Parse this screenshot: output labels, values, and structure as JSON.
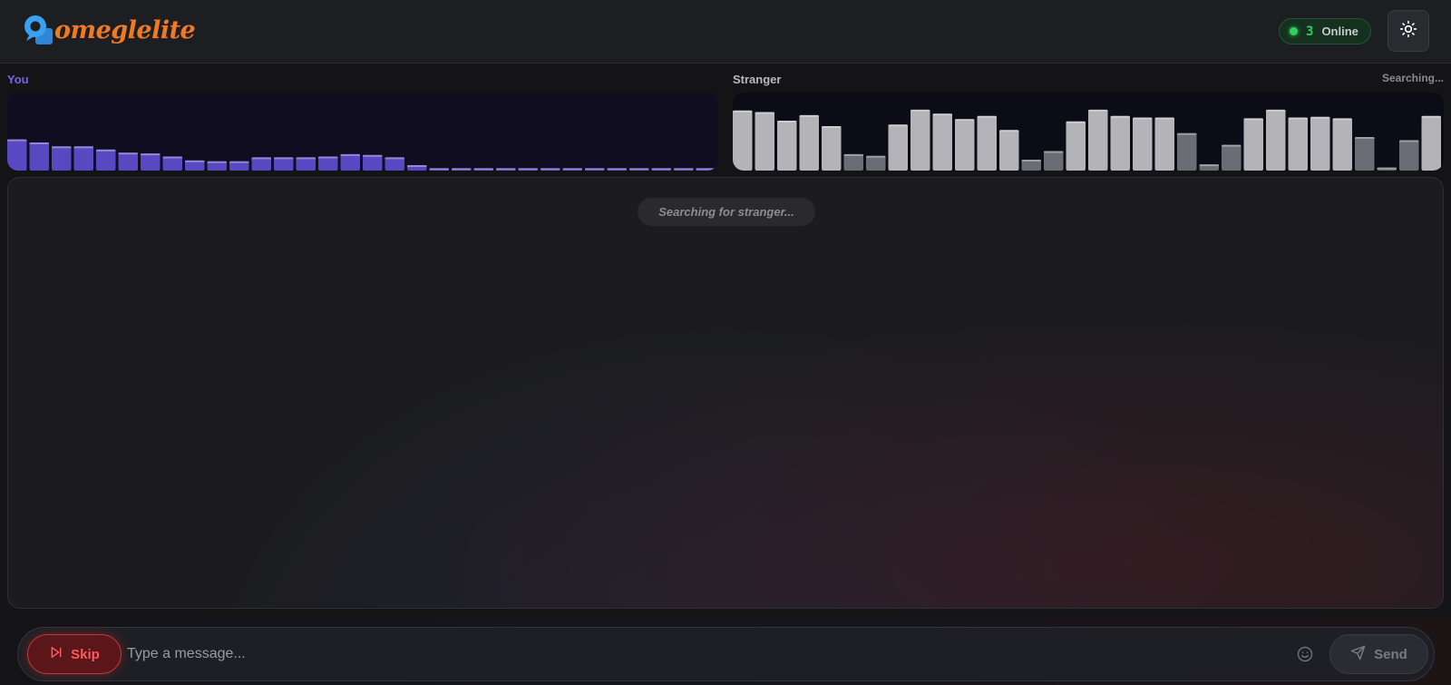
{
  "header": {
    "logo_text": "omeglelite",
    "online_count": "3",
    "online_label": "Online",
    "theme_toggle_icon": "sun-icon"
  },
  "video": {
    "you_label": "You",
    "stranger_label": "Stranger",
    "stranger_status": "Searching...",
    "you_levels": [
      0.4,
      0.36,
      0.31,
      0.31,
      0.27,
      0.23,
      0.22,
      0.18,
      0.13,
      0.12,
      0.12,
      0.17,
      0.17,
      0.17,
      0.18,
      0.21,
      0.2,
      0.17,
      0.07,
      0.03,
      0.03,
      0.03,
      0.03,
      0.03,
      0.03,
      0.03,
      0.03,
      0.03,
      0.03,
      0.03,
      0.03,
      0.03
    ],
    "stranger_levels": [
      0.77,
      0.75,
      0.64,
      0.71,
      0.57,
      0.21,
      0.19,
      0.59,
      0.78,
      0.73,
      0.66,
      0.7,
      0.52,
      0.14,
      0.25,
      0.63,
      0.78,
      0.7,
      0.68,
      0.68,
      0.48,
      0.08,
      0.33,
      0.67,
      0.78,
      0.68,
      0.69,
      0.67,
      0.43,
      0.04,
      0.39,
      0.7
    ],
    "colors": {
      "you_bar": "#5a48c2",
      "stranger_bar_hi": "#b3b3b8",
      "stranger_bar_lo": "#6c6d74"
    }
  },
  "chat": {
    "status_text": "Searching for stranger..."
  },
  "controls": {
    "skip_label": "Skip",
    "skip_icon": "skip-forward-icon",
    "message_placeholder": "Type a message...",
    "emoji_icon": "smiley-icon",
    "send_label": "Send",
    "send_icon": "paper-plane-icon"
  }
}
